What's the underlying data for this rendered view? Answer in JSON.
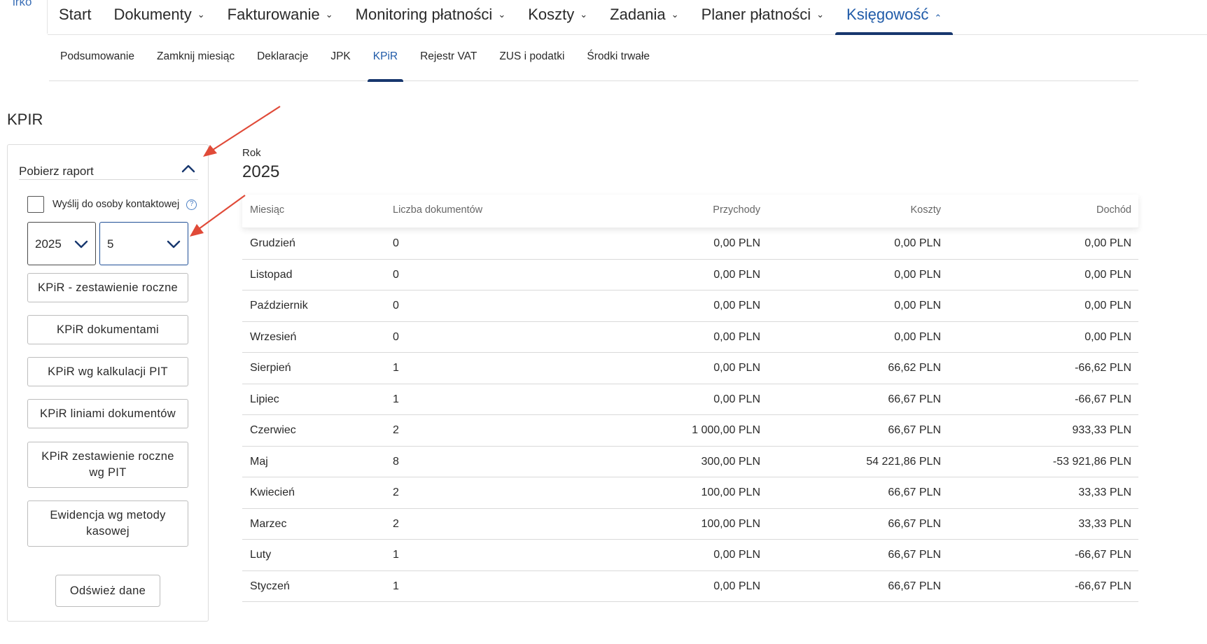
{
  "logo": {
    "text": "irko"
  },
  "top_nav": [
    {
      "label": "Start",
      "dropdown": false
    },
    {
      "label": "Dokumenty",
      "dropdown": true
    },
    {
      "label": "Fakturowanie",
      "dropdown": true
    },
    {
      "label": "Monitoring płatności",
      "dropdown": true
    },
    {
      "label": "Koszty",
      "dropdown": true
    },
    {
      "label": "Zadania",
      "dropdown": true
    },
    {
      "label": "Planer płatności",
      "dropdown": true
    },
    {
      "label": "Księgowość",
      "dropdown": true,
      "active": true
    }
  ],
  "sub_nav": [
    {
      "label": "Podsumowanie"
    },
    {
      "label": "Zamknij miesiąc"
    },
    {
      "label": "Deklaracje"
    },
    {
      "label": "JPK"
    },
    {
      "label": "KPiR",
      "active": true
    },
    {
      "label": "Rejestr VAT"
    },
    {
      "label": "ZUS i podatki"
    },
    {
      "label": "Środki trwałe"
    }
  ],
  "page_title": "KPIR",
  "report_panel": {
    "title": "Pobierz raport",
    "expanded": true,
    "send_checkbox_label": "Wyślij do osoby kontaktowej",
    "send_checkbox_checked": false,
    "help_glyph": "?",
    "year_select": "2025",
    "month_select": "5",
    "buttons": [
      "KPiR - zestawienie roczne",
      "KPiR dokumentami",
      "KPiR wg kalkulacji PIT",
      "KPiR liniami dokumentów",
      "KPiR zestawienie roczne wg PIT",
      "Ewidencja wg metody kasowej"
    ],
    "refresh_button": "Odśwież dane"
  },
  "year_label": "Rok",
  "year_value": "2025",
  "table": {
    "headers": {
      "month": "Miesiąc",
      "doc_count": "Liczba dokumentów",
      "income": "Przychody",
      "costs": "Koszty",
      "profit": "Dochód"
    },
    "rows": [
      {
        "month": "Grudzień",
        "doc_count": "0",
        "income": "0,00 PLN",
        "costs": "0,00 PLN",
        "profit": "0,00 PLN"
      },
      {
        "month": "Listopad",
        "doc_count": "0",
        "income": "0,00 PLN",
        "costs": "0,00 PLN",
        "profit": "0,00 PLN"
      },
      {
        "month": "Październik",
        "doc_count": "0",
        "income": "0,00 PLN",
        "costs": "0,00 PLN",
        "profit": "0,00 PLN"
      },
      {
        "month": "Wrzesień",
        "doc_count": "0",
        "income": "0,00 PLN",
        "costs": "0,00 PLN",
        "profit": "0,00 PLN"
      },
      {
        "month": "Sierpień",
        "doc_count": "1",
        "income": "0,00 PLN",
        "costs": "66,62 PLN",
        "profit": "-66,62 PLN"
      },
      {
        "month": "Lipiec",
        "doc_count": "1",
        "income": "0,00 PLN",
        "costs": "66,67 PLN",
        "profit": "-66,67 PLN"
      },
      {
        "month": "Czerwiec",
        "doc_count": "2",
        "income": "1 000,00 PLN",
        "costs": "66,67 PLN",
        "profit": "933,33 PLN"
      },
      {
        "month": "Maj",
        "doc_count": "8",
        "income": "300,00 PLN",
        "costs": "54 221,86 PLN",
        "profit": "-53 921,86 PLN"
      },
      {
        "month": "Kwiecień",
        "doc_count": "2",
        "income": "100,00 PLN",
        "costs": "66,67 PLN",
        "profit": "33,33 PLN"
      },
      {
        "month": "Marzec",
        "doc_count": "2",
        "income": "100,00 PLN",
        "costs": "66,67 PLN",
        "profit": "33,33 PLN"
      },
      {
        "month": "Luty",
        "doc_count": "1",
        "income": "0,00 PLN",
        "costs": "66,67 PLN",
        "profit": "-66,67 PLN"
      },
      {
        "month": "Styczeń",
        "doc_count": "1",
        "income": "0,00 PLN",
        "costs": "66,67 PLN",
        "profit": "-66,67 PLN"
      }
    ]
  },
  "colors": {
    "accent": "#1f5aa8",
    "active_underline": "#17376e",
    "annotation_arrow": "#e04a38"
  }
}
